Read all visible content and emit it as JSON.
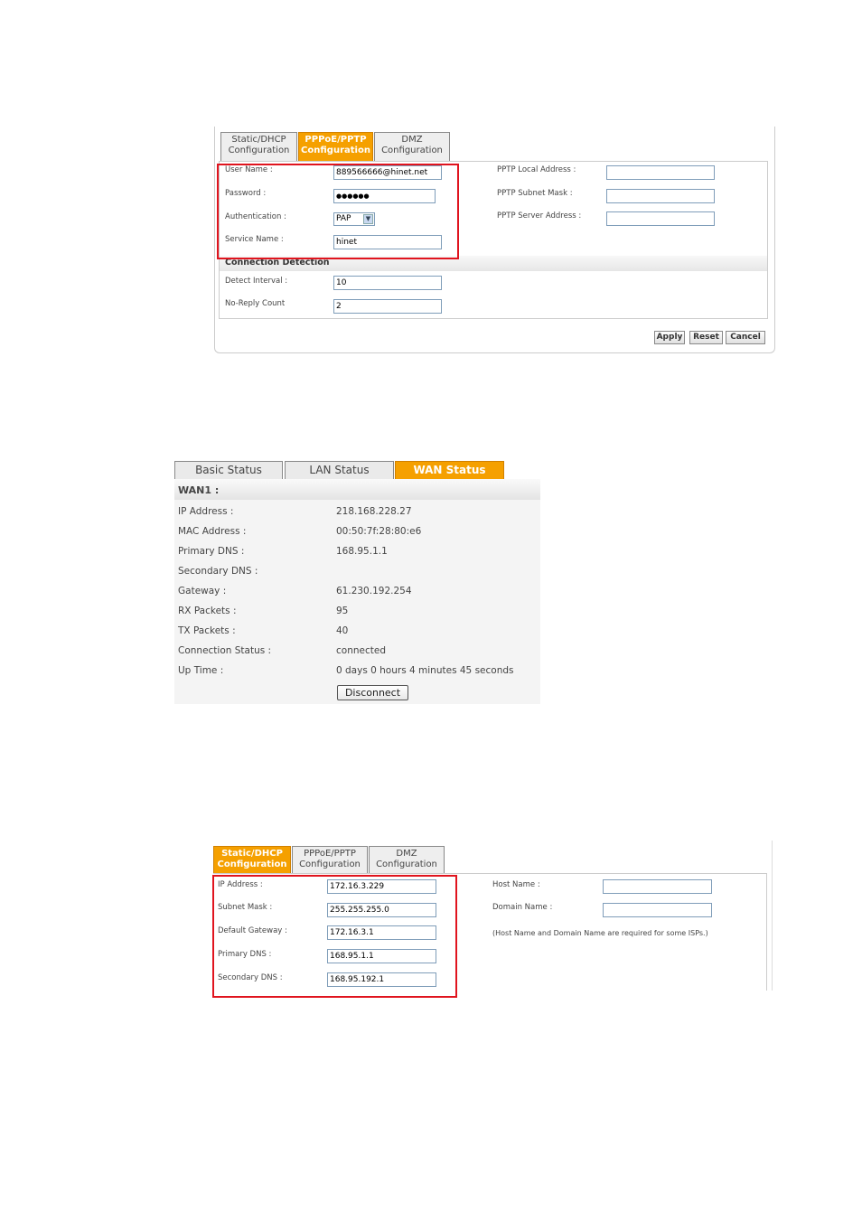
{
  "pppoe": {
    "tabs": [
      {
        "line1": "Static/DHCP",
        "line2": "Configuration"
      },
      {
        "line1": "PPPoE/PPTP",
        "line2": "Configuration"
      },
      {
        "line1": "DMZ",
        "line2": "Configuration"
      }
    ],
    "user_name_label": "User Name :",
    "user_name_value": "889566666@hinet.net",
    "password_label": "Password :",
    "password_value": "●●●●●●",
    "auth_label": "Authentication :",
    "auth_value": "PAP",
    "service_label": "Service Name :",
    "service_value": "hinet",
    "pptp_local_label": "PPTP Local Address :",
    "pptp_subnet_label": "PPTP Subnet Mask :",
    "pptp_server_label": "PPTP Server Address :",
    "conn_detect_title": "Connection Detection",
    "detect_interval_label": "Detect Interval :",
    "detect_interval_value": "10",
    "no_reply_label": "No-Reply Count",
    "no_reply_value": "2",
    "apply": "Apply",
    "reset": "Reset",
    "cancel": "Cancel"
  },
  "status": {
    "tabs": [
      "Basic Status",
      "LAN Status",
      "WAN Status"
    ],
    "section_title": "WAN1 :",
    "rows": [
      {
        "label": "IP Address :",
        "value": "218.168.228.27"
      },
      {
        "label": "MAC Address :",
        "value": "00:50:7f:28:80:e6"
      },
      {
        "label": "Primary DNS :",
        "value": "168.95.1.1"
      },
      {
        "label": "Secondary DNS :",
        "value": ""
      },
      {
        "label": "Gateway :",
        "value": "61.230.192.254"
      },
      {
        "label": "RX Packets :",
        "value": "95"
      },
      {
        "label": "TX Packets :",
        "value": "40"
      },
      {
        "label": "Connection Status :",
        "value": "connected"
      },
      {
        "label": "Up Time :",
        "value": "0 days 0 hours 4 minutes 45 seconds"
      }
    ],
    "disconnect": "Disconnect"
  },
  "static": {
    "tabs": [
      {
        "line1": "Static/DHCP",
        "line2": "Configuration"
      },
      {
        "line1": "PPPoE/PPTP",
        "line2": "Configuration"
      },
      {
        "line1": "DMZ",
        "line2": "Configuration"
      }
    ],
    "ip_label": "IP Address :",
    "ip_value": "172.16.3.229",
    "mask_label": "Subnet Mask :",
    "mask_value": "255.255.255.0",
    "gw_label": "Default Gateway :",
    "gw_value": "172.16.3.1",
    "pdns_label": "Primary DNS :",
    "pdns_value": "168.95.1.1",
    "sdns_label": "Secondary DNS :",
    "sdns_value": "168.95.192.1",
    "host_label": "Host Name :",
    "domain_label": "Domain Name :",
    "note": "(Host Name and Domain Name are required for some ISPs.)"
  },
  "colors": {
    "accent": "#f5a000",
    "highlight": "#e0141e"
  }
}
